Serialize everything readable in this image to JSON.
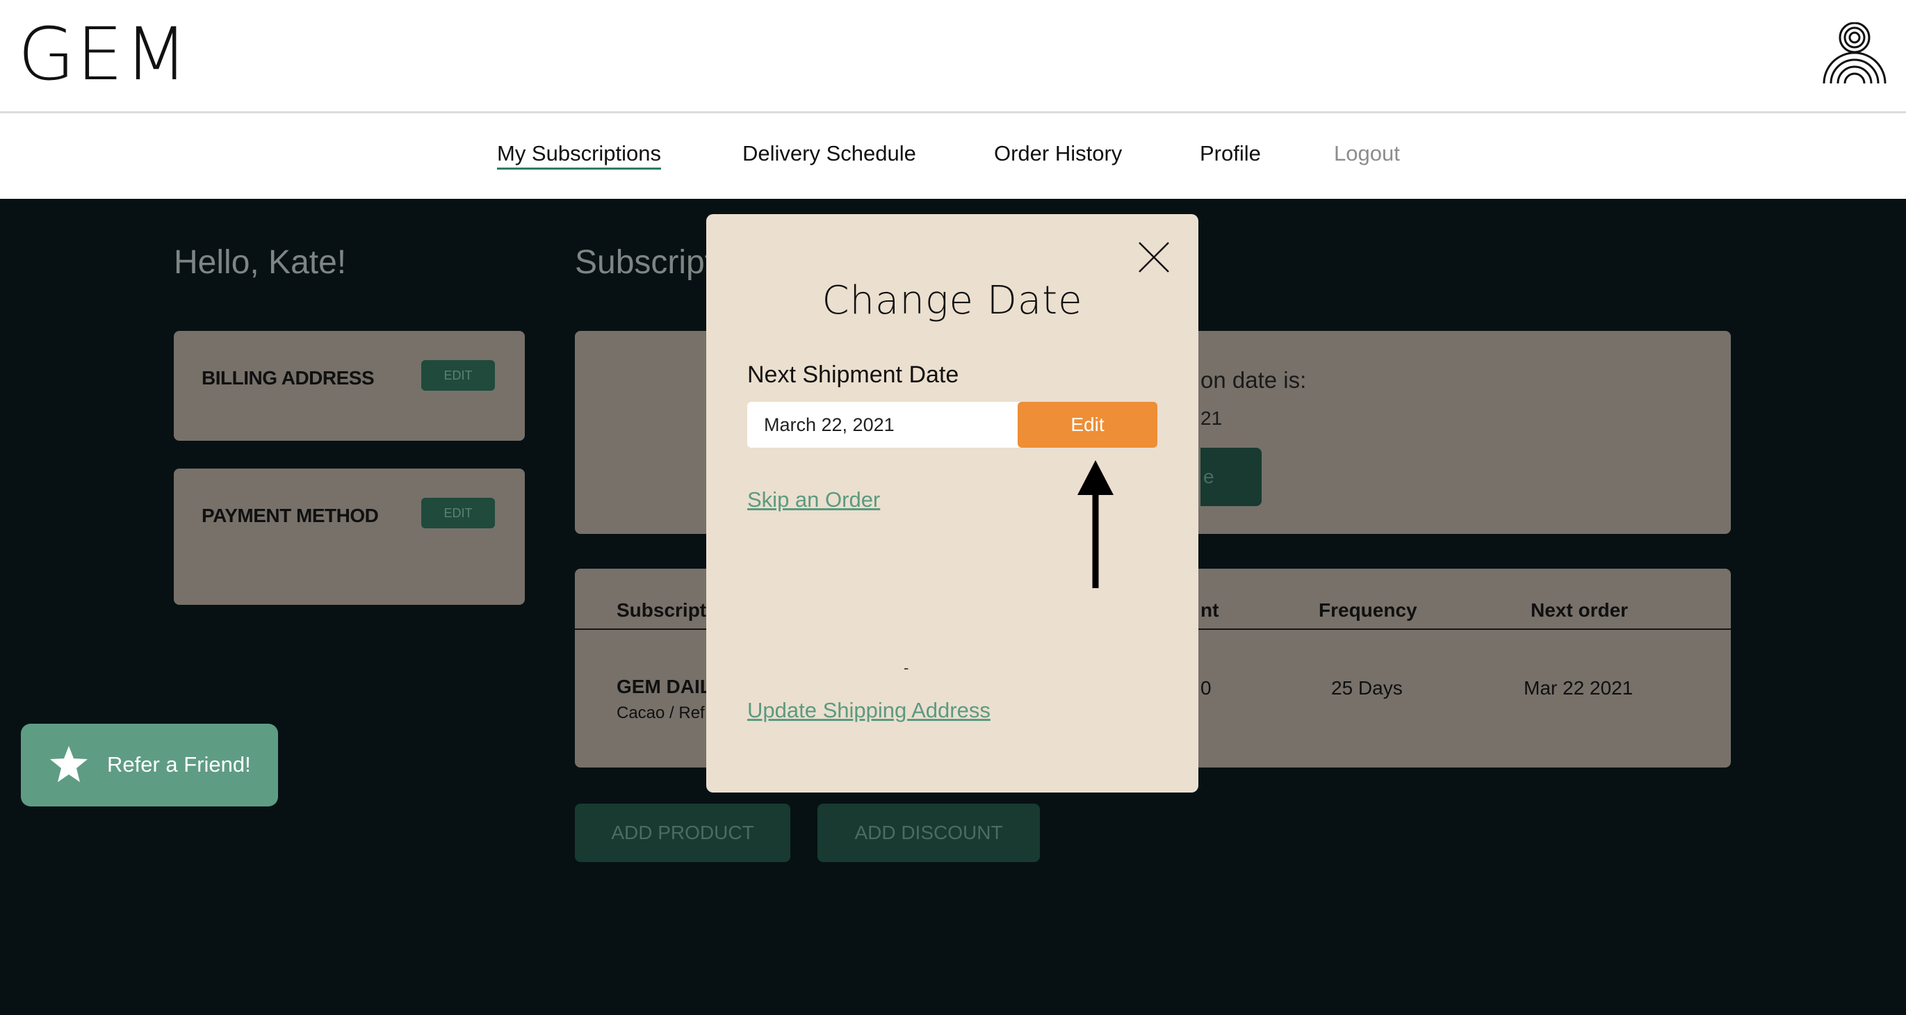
{
  "header": {
    "logo": "GEM",
    "user_icon": "rainbow-person-icon"
  },
  "nav": {
    "items": [
      {
        "label": "My Subscriptions"
      },
      {
        "label": "Delivery Schedule"
      },
      {
        "label": "Order History"
      },
      {
        "label": "Profile"
      },
      {
        "label": "Logout"
      }
    ]
  },
  "page": {
    "greeting": "Hello, Kate!",
    "section_title": "Subscripti",
    "billing": {
      "label": "BILLING ADDRESS",
      "edit": "EDIT"
    },
    "payment": {
      "label": "PAYMENT METHOD",
      "edit": "EDIT"
    },
    "info_card": {
      "line1": "on date is:",
      "line2": "21",
      "button_fragment": "e"
    },
    "table": {
      "headers": {
        "subscription": "Subscripti",
        "amount": "nt",
        "frequency": "Frequency",
        "next_order": "Next order"
      },
      "row": {
        "product": "GEM DAILY",
        "variant": "Cacao / Ref",
        "amount": "0",
        "frequency": "25 Days",
        "next_order": "Mar 22 2021"
      }
    },
    "add_product": "ADD PRODUCT",
    "add_discount": "ADD DISCOUNT"
  },
  "refer": {
    "label": "Refer a Friend!",
    "icon": "star-icon"
  },
  "modal": {
    "title": "Change Date",
    "field_label": "Next Shipment Date",
    "date_value": "March 22, 2021",
    "edit_label": "Edit",
    "skip_link": "Skip an Order",
    "dash": "-",
    "update_link": "Update Shipping Address",
    "close_icon": "close-icon"
  },
  "colors": {
    "accent_orange": "#ee8e36",
    "link_green": "#5b9a80",
    "modal_bg": "#ebdfcf",
    "page_dark": "#071114"
  }
}
